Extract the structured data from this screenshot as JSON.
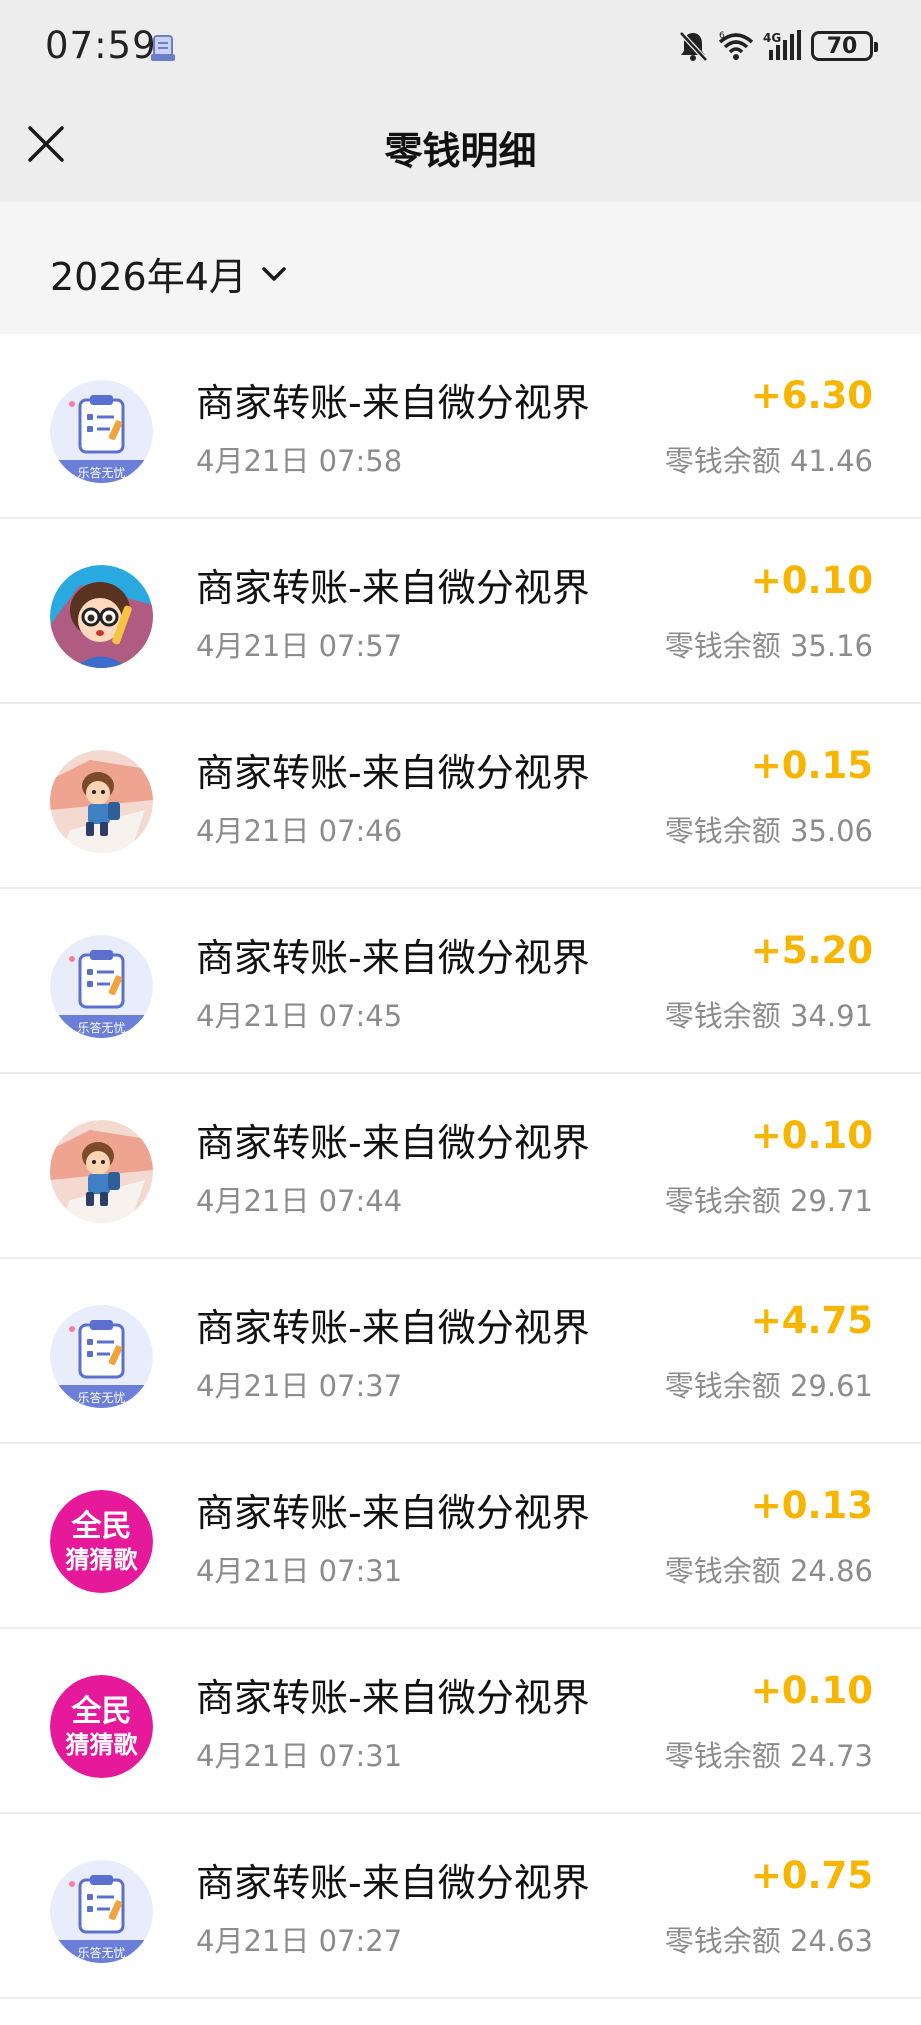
{
  "status_bar": {
    "time": "07:59",
    "battery": "70",
    "network": "4G"
  },
  "header": {
    "title": "零钱明细"
  },
  "filter": {
    "month": "2026年4月"
  },
  "transactions": [
    {
      "avatar": "clipboard-app-icon",
      "title": "商家转账-来自微分视界",
      "time": "4月21日 07:58",
      "amount": "+6.30",
      "balance": "零钱余额 41.46"
    },
    {
      "avatar": "girl-with-glasses-avatar",
      "title": "商家转账-来自微分视界",
      "time": "4月21日 07:57",
      "amount": "+0.10",
      "balance": "零钱余额 35.16"
    },
    {
      "avatar": "boy-with-backpack-avatar",
      "title": "商家转账-来自微分视界",
      "time": "4月21日 07:46",
      "amount": "+0.15",
      "balance": "零钱余额 35.06"
    },
    {
      "avatar": "clipboard-app-icon",
      "title": "商家转账-来自微分视界",
      "time": "4月21日 07:45",
      "amount": "+5.20",
      "balance": "零钱余额 34.91"
    },
    {
      "avatar": "boy-with-backpack-avatar",
      "title": "商家转账-来自微分视界",
      "time": "4月21日 07:44",
      "amount": "+0.10",
      "balance": "零钱余额 29.71"
    },
    {
      "avatar": "clipboard-app-icon",
      "title": "商家转账-来自微分视界",
      "time": "4月21日 07:37",
      "amount": "+4.75",
      "balance": "零钱余额 29.61"
    },
    {
      "avatar": "guess-song-app-icon",
      "title": "商家转账-来自微分视界",
      "time": "4月21日 07:31",
      "amount": "+0.13",
      "balance": "零钱余额 24.86"
    },
    {
      "avatar": "guess-song-app-icon",
      "title": "商家转账-来自微分视界",
      "time": "4月21日 07:31",
      "amount": "+0.10",
      "balance": "零钱余额 24.73"
    },
    {
      "avatar": "clipboard-app-icon",
      "title": "商家转账-来自微分视界",
      "time": "4月21日 07:27",
      "amount": "+0.75",
      "balance": "零钱余额 24.63"
    }
  ],
  "avatar_text": {
    "clipboard_banner": "乐答无忧",
    "guess_song_line1": "全民",
    "guess_song_line2": "猜猜歌"
  },
  "colors": {
    "amount": "#f7b500",
    "header_bg": "#ededed",
    "filter_bg": "#f5f5f5",
    "secondary_text": "#8c8c8c",
    "guess_song_bg": "#e6199b"
  }
}
